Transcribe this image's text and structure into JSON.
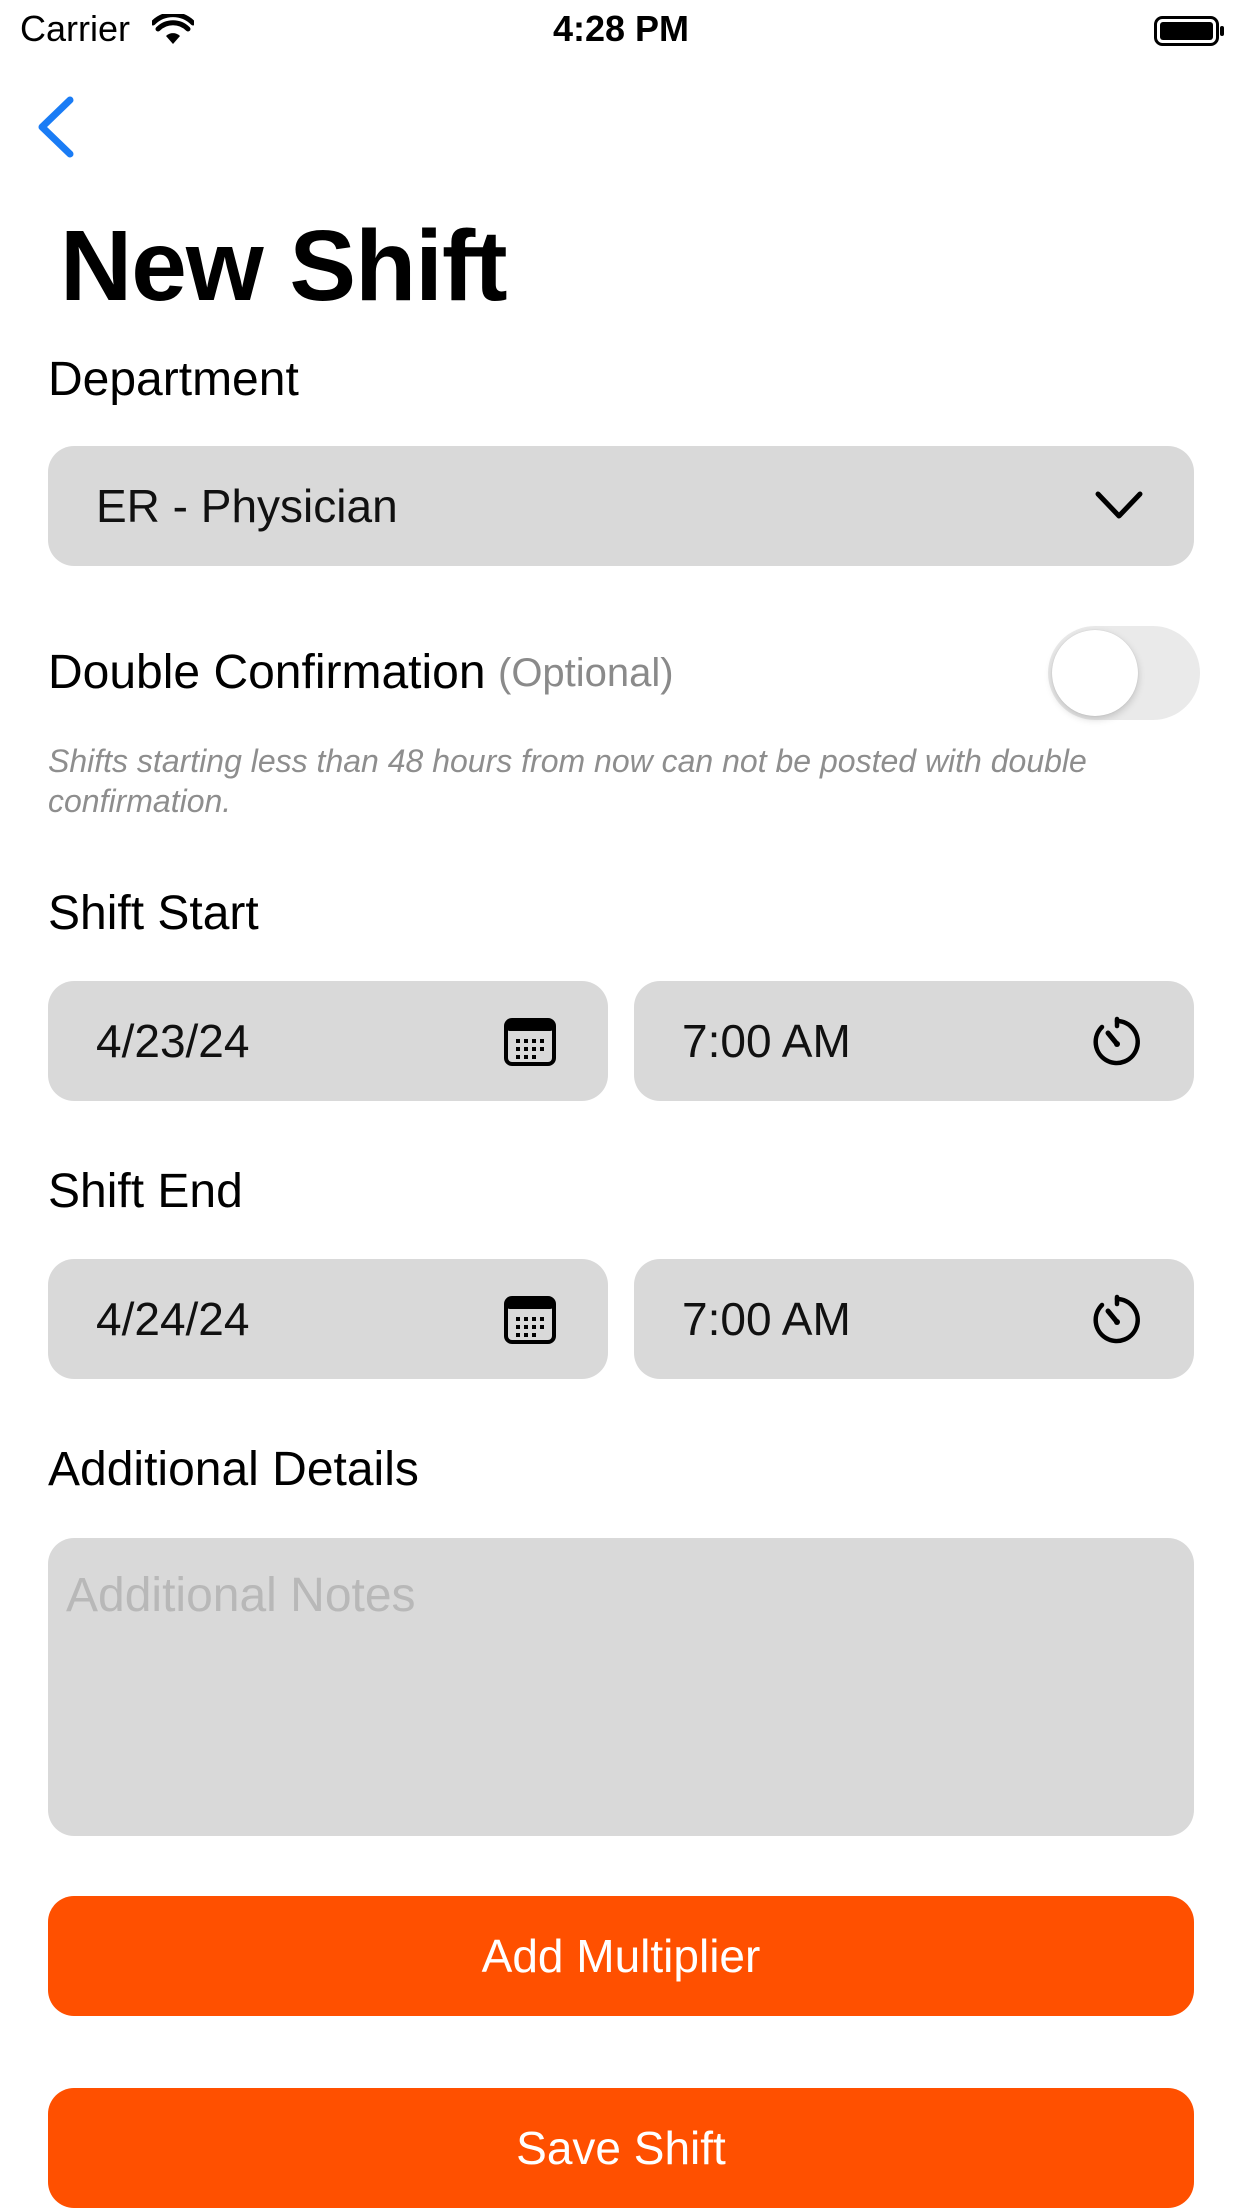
{
  "status_bar": {
    "carrier": "Carrier",
    "time": "4:28 PM",
    "wifi_icon": "wifi-icon",
    "battery_icon": "battery-full-icon"
  },
  "nav": {
    "back_icon": "chevron-left-icon",
    "back_color": "#1a7cf5"
  },
  "page": {
    "title": "New Shift"
  },
  "department": {
    "label": "Department",
    "value": "ER - Physician",
    "icon": "chevron-down-icon"
  },
  "double_confirmation": {
    "label": "Double Confirmation",
    "optional": "(Optional)",
    "enabled": false,
    "helper": "Shifts starting less than 48 hours from now can not be posted with double confirmation."
  },
  "shift_start": {
    "label": "Shift Start",
    "date": "4/23/24",
    "time": "7:00 AM",
    "date_icon": "calendar-icon",
    "time_icon": "clock-icon"
  },
  "shift_end": {
    "label": "Shift End",
    "date": "4/24/24",
    "time": "7:00 AM",
    "date_icon": "calendar-icon",
    "time_icon": "clock-icon"
  },
  "details": {
    "label": "Additional Details",
    "placeholder": "Additional Notes",
    "value": ""
  },
  "actions": {
    "add_multiplier": "Add Multiplier",
    "save_shift": "Save Shift"
  },
  "colors": {
    "accent": "#ff5000",
    "field_background": "#d9d9d9",
    "link": "#1a7cf5"
  }
}
